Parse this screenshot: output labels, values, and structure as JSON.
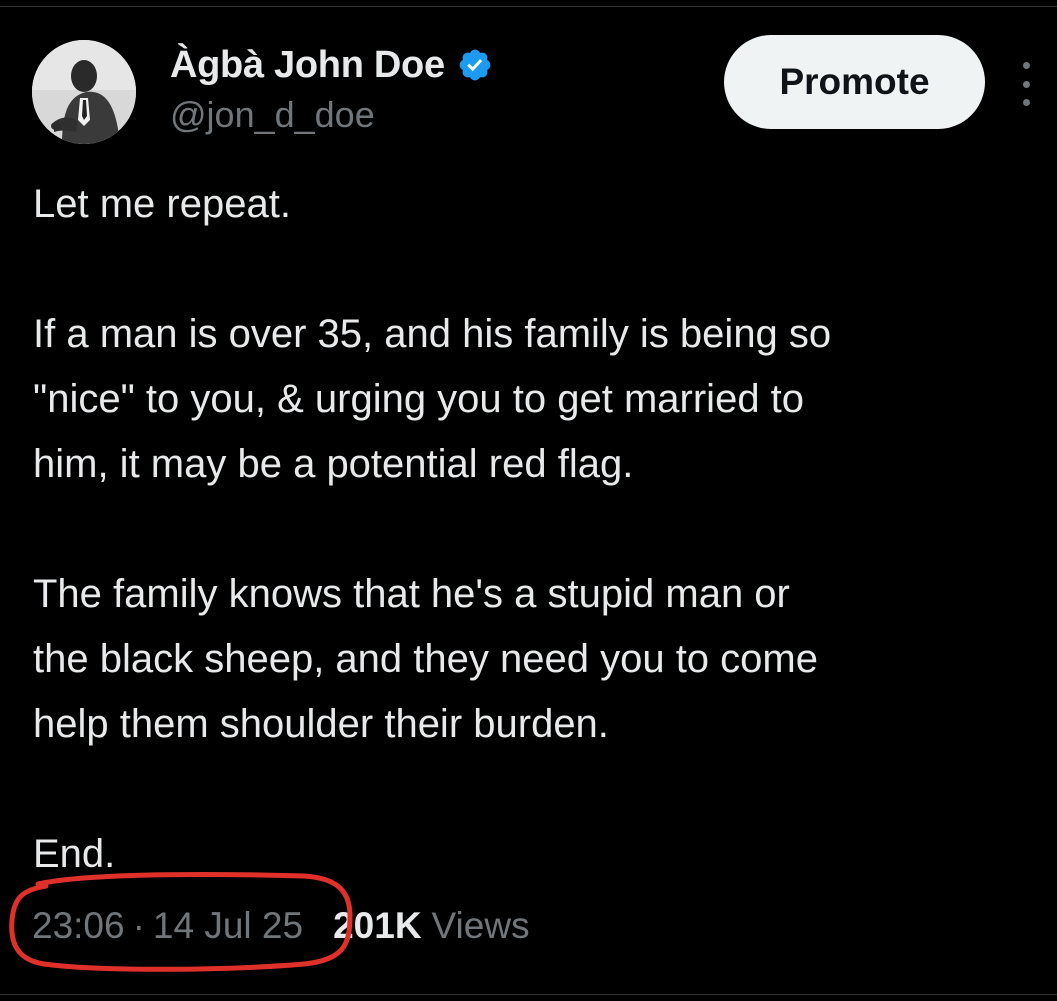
{
  "author": {
    "display_name": "Àgbà John Doe",
    "handle": "@jon_d_doe",
    "verified": true,
    "verified_color": "#1d9bf0"
  },
  "actions": {
    "promote_label": "Promote",
    "more_icon": "more-vertical-icon"
  },
  "tweet": {
    "lines": [
      "Let me repeat.",
      "",
      "If a man is over 35, and his family is being so",
      "\"nice\" to you, & urging you to get married to",
      "him, it may be a potential red flag.",
      "",
      "The family knows that he's a stupid man or",
      "the black sheep, and they need you to come",
      "help them shoulder their burden.",
      "",
      "End."
    ]
  },
  "meta": {
    "time": "23:06",
    "separator": "·",
    "date": "14 Jul 25",
    "views_count": "201K",
    "views_label": "Views"
  },
  "colors": {
    "background": "#000000",
    "text_primary": "#e7e9ea",
    "text_secondary": "#71767b",
    "annotation": "#e0302a"
  }
}
